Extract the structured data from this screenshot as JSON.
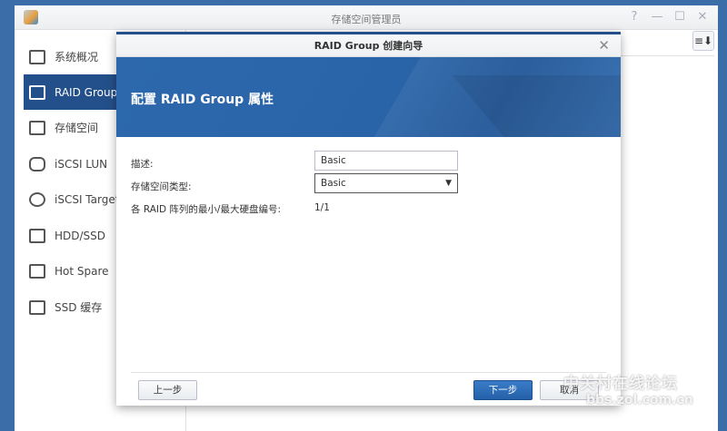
{
  "window": {
    "title": "存储空间管理员",
    "controls": [
      "?",
      "—",
      "☐",
      "✕"
    ]
  },
  "sidebar": {
    "items": [
      {
        "label": "系统概况",
        "icon": "overview-icon"
      },
      {
        "label": "RAID Group",
        "icon": "raid-icon",
        "active": true
      },
      {
        "label": "存储空间",
        "icon": "volume-icon"
      },
      {
        "label": "iSCSI LUN",
        "icon": "lun-icon"
      },
      {
        "label": "iSCSI Target",
        "icon": "target-icon"
      },
      {
        "label": "HDD/SSD",
        "icon": "hdd-icon"
      },
      {
        "label": "Hot Spare",
        "icon": "hot-spare-icon"
      },
      {
        "label": "SSD 缓存",
        "icon": "ssd-cache-icon"
      }
    ]
  },
  "toolbar": {
    "sort_icon": "≡⬇"
  },
  "dialog": {
    "title": "RAID Group 创建向导",
    "close": "✕",
    "heading": "配置 RAID Group 属性",
    "form": {
      "desc_label": "描述:",
      "desc_value": "Basic",
      "type_label": "存储空间类型:",
      "type_value": "Basic",
      "disk_label": "各 RAID 阵列的最小/最大硬盘编号:",
      "disk_value": "1/1"
    },
    "buttons": {
      "back": "上一步",
      "next": "下一步",
      "cancel": "取消"
    }
  },
  "watermark": {
    "line1": "中关村在线论坛",
    "line2": "bbs.zol.com.cn"
  }
}
